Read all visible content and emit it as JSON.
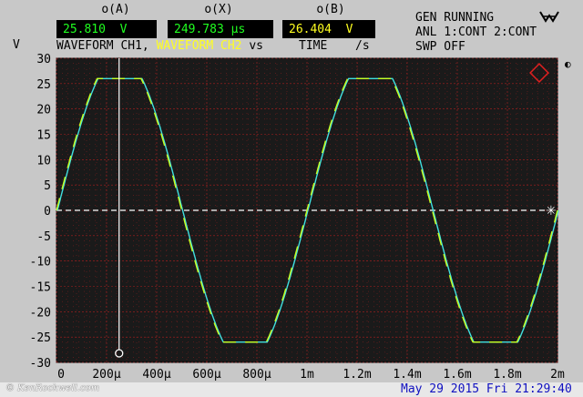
{
  "header": {
    "cursor_a": {
      "label": "o(A)",
      "value": "25.810",
      "unit": "V",
      "color": "#20ff20"
    },
    "cursor_x": {
      "label": "o(X)",
      "value": "249.783",
      "unit": "μs",
      "color": "#20ff20"
    },
    "cursor_b": {
      "label": "o(B)",
      "value": "26.404",
      "unit": "V",
      "color": "#ffff20"
    },
    "status_lines": [
      "GEN RUNNING",
      "ANL 1:CONT 2:CONT",
      "SWP OFF"
    ],
    "waveform_prefix": "WAVEFORM CH1,",
    "waveform_ch2": "WAVEFORM CH2",
    "vs": "vs",
    "time": "TIME",
    "time_unit": "/s",
    "y_unit": "V"
  },
  "colors": {
    "background": "#c8c8c8",
    "plot_bg": "#1a1a1a",
    "grid": "#c02020",
    "trace_ch1": "#40e0e0",
    "trace_ch2": "#c8ff20",
    "cursor": "#ffffff",
    "footer_text": "#1010c0"
  },
  "footer": {
    "watermark": "© KenRockwell.com",
    "datetime": "May 29 2015 Fri 21:29:40"
  },
  "icons": {
    "logo": "rohde-schwarz-logo-icon",
    "status": "connection-status-icon",
    "marker": "side-marker-icon"
  },
  "chart_data": {
    "type": "line",
    "xlim": [
      0,
      0.002
    ],
    "ylim": [
      -30,
      30
    ],
    "x_ticks": [
      "0",
      "200μ",
      "400μ",
      "600μ",
      "800μ",
      "1m",
      "1.2m",
      "1.4m",
      "1.6m",
      "1.8m",
      "2m"
    ],
    "y_ticks": [
      "30",
      "25",
      "20",
      "15",
      "10",
      "5",
      "0",
      "-5",
      "-10",
      "-15",
      "-20",
      "-25",
      "-30"
    ],
    "series": [
      {
        "name": "WAVEFORM CH1",
        "description_amplitude": 30.5,
        "frequency_hz": 1000,
        "clip": 26.0
      }
    ],
    "cursor_x_time": 0.00025,
    "zero_ref": 0
  }
}
